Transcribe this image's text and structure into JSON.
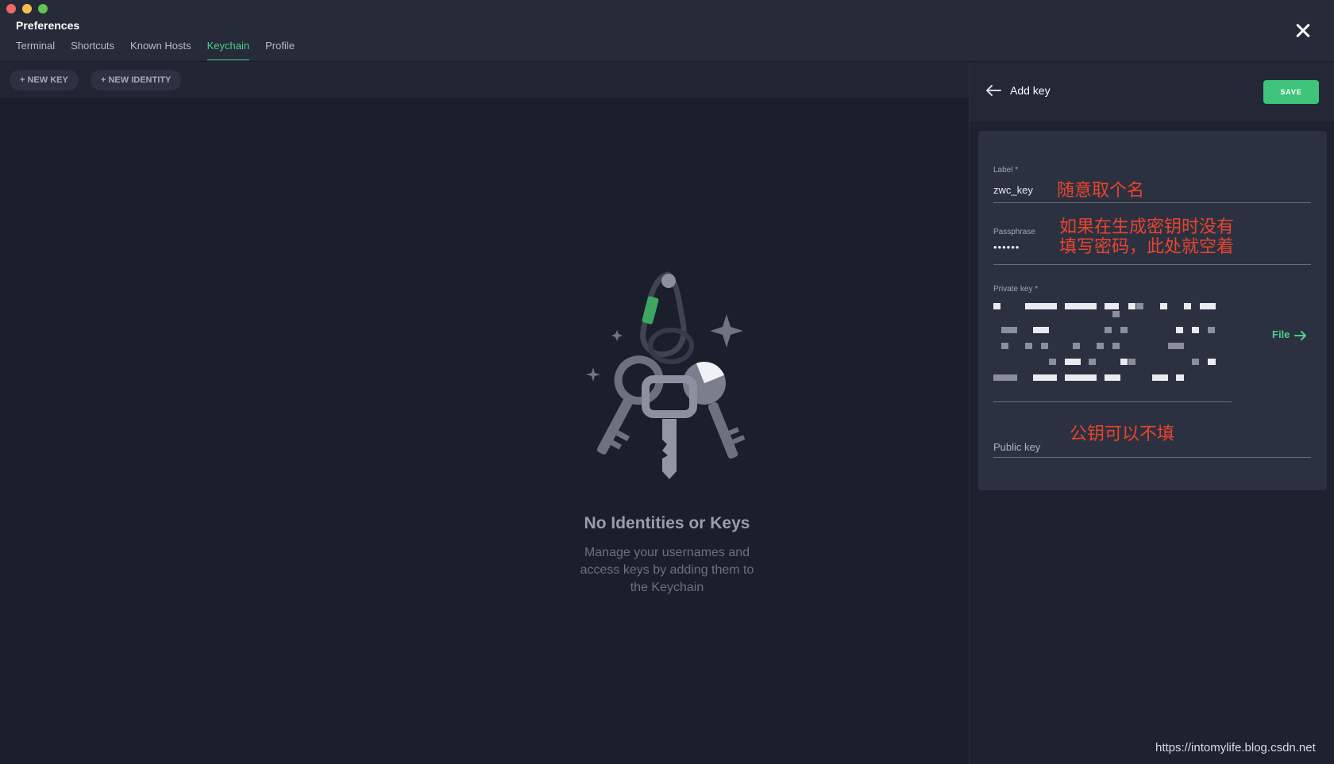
{
  "window": {
    "title": "Preferences"
  },
  "tabs": [
    {
      "label": "Terminal",
      "active": false
    },
    {
      "label": "Shortcuts",
      "active": false
    },
    {
      "label": "Known Hosts",
      "active": false
    },
    {
      "label": "Keychain",
      "active": true
    },
    {
      "label": "Profile",
      "active": false
    }
  ],
  "toolbar": {
    "new_key": "+ NEW KEY",
    "new_identity": "+ NEW IDENTITY"
  },
  "empty_state": {
    "title": "No Identities or Keys",
    "description": "Manage your usernames and access keys by adding them to the Keychain"
  },
  "panel": {
    "title": "Add key",
    "save_label": "SAVE",
    "fields": {
      "label": {
        "label": "Label *",
        "value": "zwc_key"
      },
      "passphrase": {
        "label": "Passphrase",
        "value": "••••••"
      },
      "private_key": {
        "label": "Private key *",
        "file_label": "File"
      },
      "public_key": {
        "placeholder": "Public key"
      }
    }
  },
  "annotations": {
    "label_note": "随意取个名",
    "passphrase_note_line1": "如果在生成密钥时没有",
    "passphrase_note_line2": "填写密码，此处就空着",
    "public_key_note": "公钥可以不填"
  },
  "watermark": "https://intomylife.blog.csdn.net",
  "colors": {
    "accent": "#4cd08a",
    "save": "#3fc47c",
    "annotation": "#e8452c",
    "background": "#1a1e2c"
  }
}
